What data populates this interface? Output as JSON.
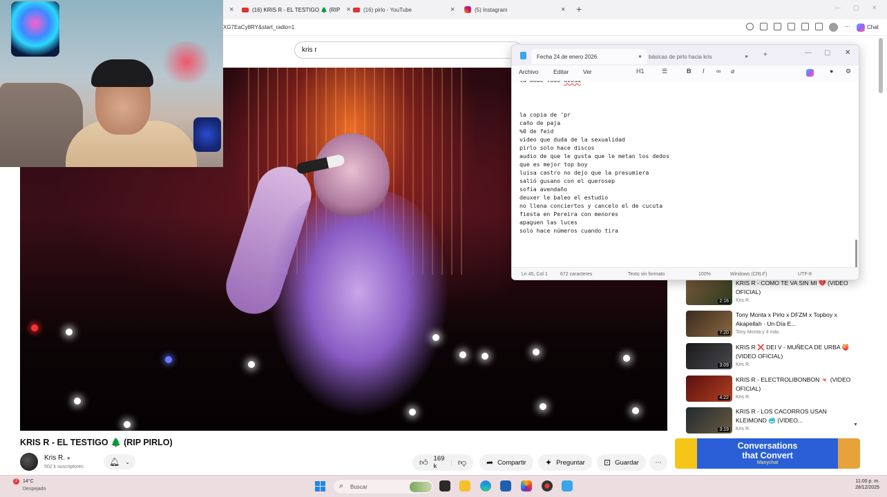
{
  "browser": {
    "tabs": [
      {
        "label": "(16) KRIS R - EL TESTIGO 🌲 (RIP",
        "active": true
      },
      {
        "label": "(16) pirlo - YouTube",
        "active": false
      },
      {
        "label": "(5) Instagram",
        "active": false
      }
    ],
    "url": "XG7EaCy8RY&start_radio=1"
  },
  "youtube": {
    "search_value": "kris r",
    "video_title": "KRIS R - EL TESTIGO 🌲 (RIP PIRLO)",
    "channel": "Kris R.",
    "subscribers": "502 k suscriptores",
    "actions": {
      "like_count": "169 k",
      "share": "Compartir",
      "ask": "Preguntar",
      "save": "Guardar",
      "more": "⋯"
    },
    "recommendations": [
      {
        "title": "KRIS R - COMO TE VA SIN MI 💔 (VIDEO OFICIAL)",
        "channel": "Kris R.",
        "duration": "2:16",
        "colors": [
          "#7a5a3a",
          "#2a3a20"
        ]
      },
      {
        "title": "Tony Monta x Pirlo x DFZM x Topboy x Akapellah · Un Día E...",
        "channel": "Tony Monta y 4 más",
        "duration": "7:20",
        "colors": [
          "#3a2a20",
          "#8a6a40"
        ]
      },
      {
        "title": "KRIS R ❌ DEI V - MUÑECA DE URBA 🍑 (VIDEO OFICIAL)",
        "channel": "Kris R.",
        "duration": "3:09",
        "colors": [
          "#1a1a1a",
          "#4a4a50"
        ]
      },
      {
        "title": "KRIS R - ELECTROLIBONBON 🍬 (VIDEO OFICIAL)",
        "channel": "Kris R.",
        "duration": "4:22",
        "colors": [
          "#5a1010",
          "#b04020"
        ]
      },
      {
        "title": "KRIS R - LOS CACORROS USAN KLEIMOND 🥶 (VIDEO...",
        "channel": "Kris R.",
        "duration": "3:19",
        "colors": [
          "#202a30",
          "#6a5a40"
        ]
      }
    ],
    "ad": {
      "line1": "Conversations",
      "line2": "that Convert",
      "brand": "Manychat"
    }
  },
  "notepad": {
    "tabs": [
      {
        "label": "Fecha 24 de enero 2026",
        "active": true
      },
      {
        "label": "básicas de pirlo hacia kris",
        "active": false
      }
    ],
    "menu": [
      "Archivo",
      "Editar",
      "Ver"
    ],
    "heading_btn": "H1",
    "lines": [
      "la copia de 'pr",
      "caño de paja",
      "%0 de feid",
      "video que duda de la sexualidad",
      "pirlo solo hace discos",
      "audio de que le gusta que le metan los dedos",
      "que es mejor top boy",
      "luisa castro no dejo que la presumiera",
      "salió gusano con el querosep",
      "sofía avendaño",
      "deuxer le baleo el estudio",
      "no llena conciertos y cancelo el de cucuta",
      "fiesta en Pereira con menores",
      "apaguen las luces",
      "solo hace números cuando tira"
    ],
    "status": {
      "position": "Ln 45, Col 1",
      "chars": "672 caracteres",
      "format": "Texto sin formato",
      "zoom": "100%",
      "eol": "Windows (CRLF)",
      "encoding": "UTF-8"
    }
  },
  "taskbar": {
    "weather_temp": "14°C",
    "weather_desc": "Despejado",
    "weather_badge": "2",
    "search_label": "Buscar",
    "time": "11:00 p. m.",
    "date": "28/12/2025"
  },
  "colors": {
    "youtube_red": "#e03030",
    "taskbar": "#ecdde0",
    "notepad_bg": "#fbfbfd"
  }
}
